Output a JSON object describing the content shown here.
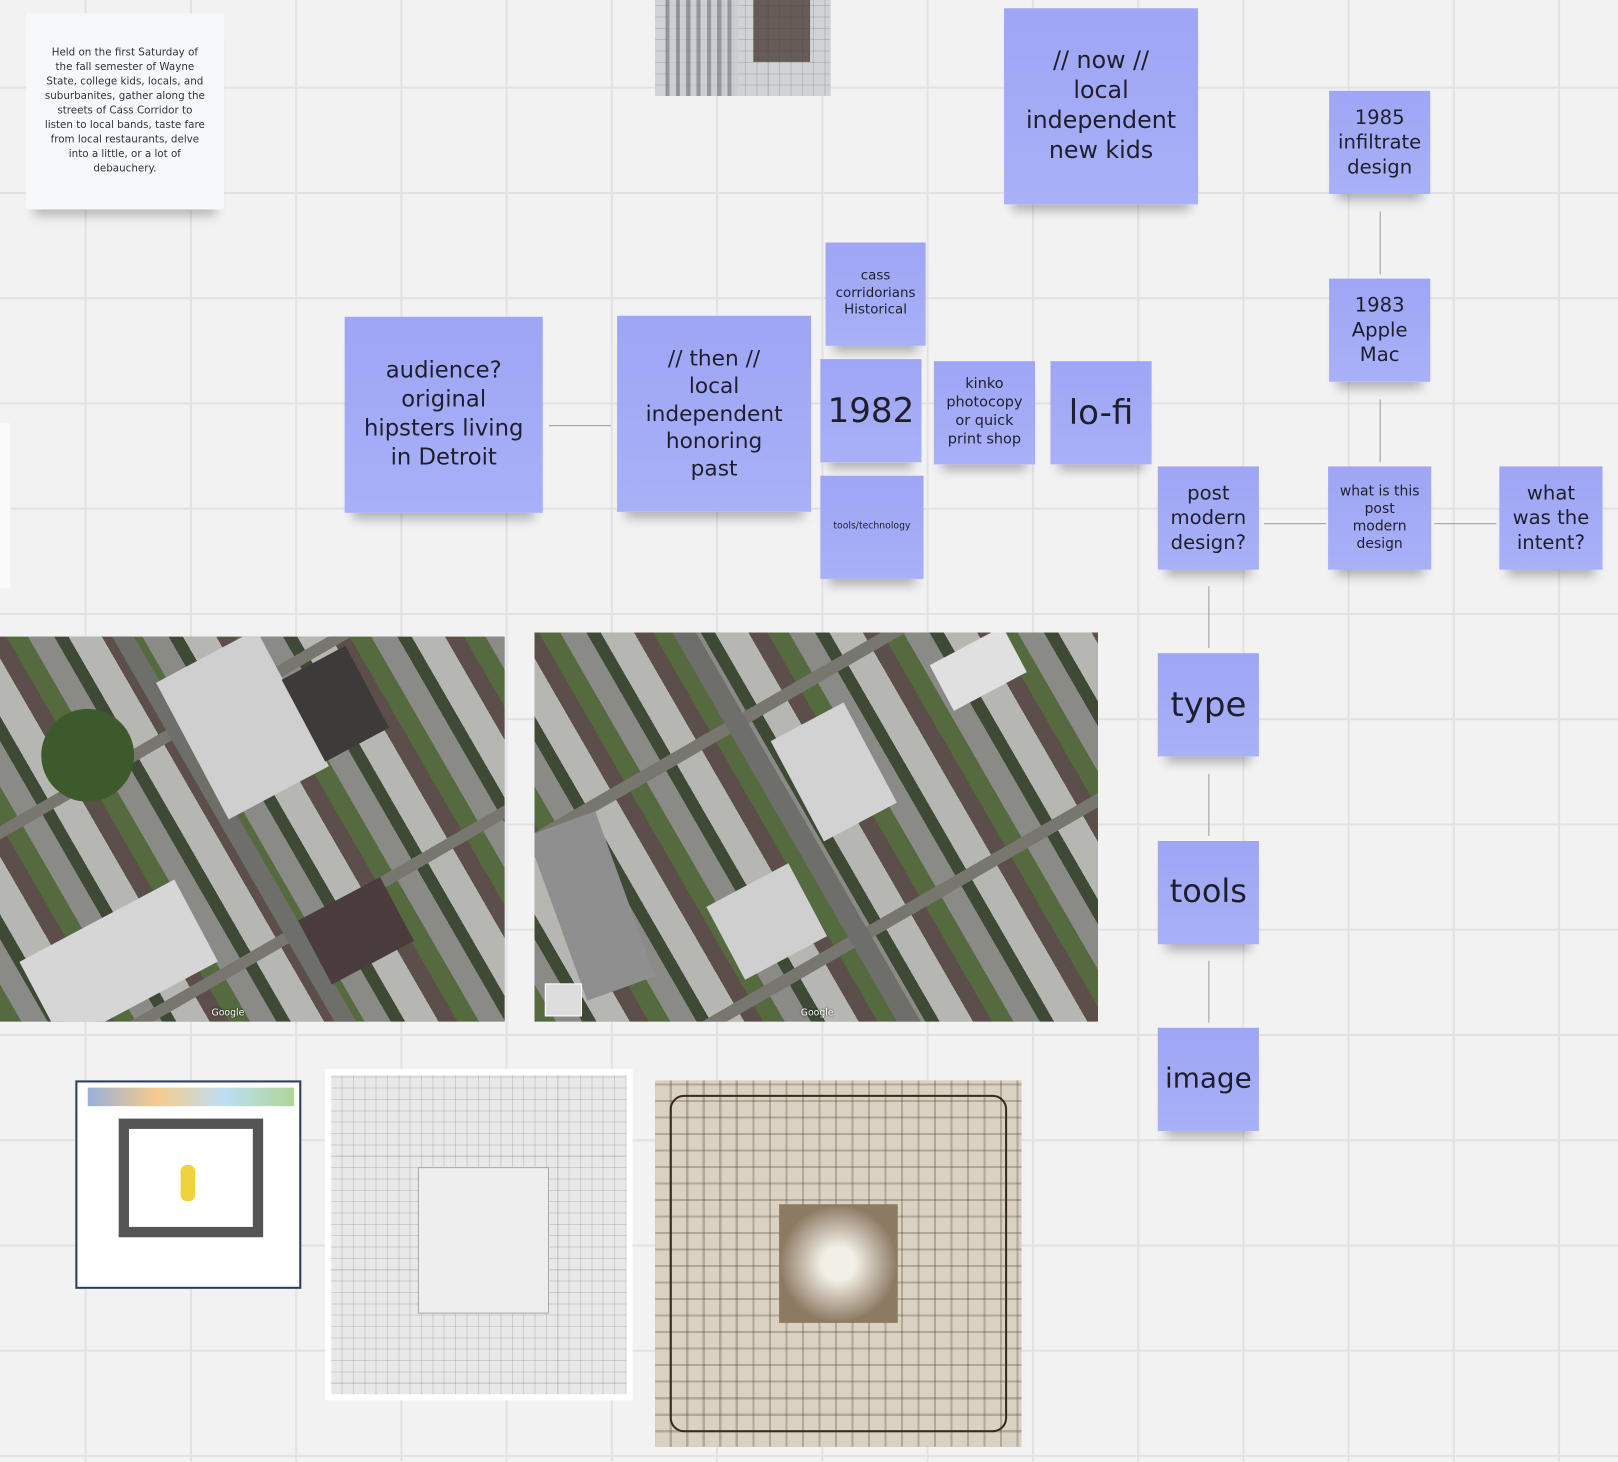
{
  "board": {
    "text_note": "Held on the first Saturday of the fall semester of Wayne State, college kids, locals, and suburbanites, gather along the streets of Cass Corridor to listen to local bands, taste fare from local restaurants,  delve into a little, or a lot of debauchery.",
    "stickies": {
      "now": "// now //\nlocal\nindependent\nnew kids",
      "y1985": "1985\ninfiltrate\ndesign",
      "y1983": "1983\nApple\nMac",
      "cass": "cass\ncorridorians\nHistorical",
      "audience": "audience?\noriginal\nhipsters living\nin Detroit",
      "then": "// then //\nlocal\nindependent\nhonoring\npast",
      "y1982": "1982",
      "kinko": "kinko\nphotocopy\nor quick\nprint shop",
      "lofi": "lo-fi",
      "tools_tech": "tools/technology",
      "post_modern": "post\nmodern\ndesign?",
      "what_is": "what is this\npost\nmodern\ndesign",
      "intent": "what\nwas the\nintent?",
      "type": "type",
      "tools": "tools",
      "image": "image"
    },
    "maps": [
      {
        "attribution": "Google"
      },
      {
        "attribution": "Google"
      }
    ],
    "colors": {
      "sticky": "#a0a8f5",
      "canvas": "#f2f2f2",
      "note": "#f7f8fa",
      "connector": "#9a9a9a"
    }
  }
}
